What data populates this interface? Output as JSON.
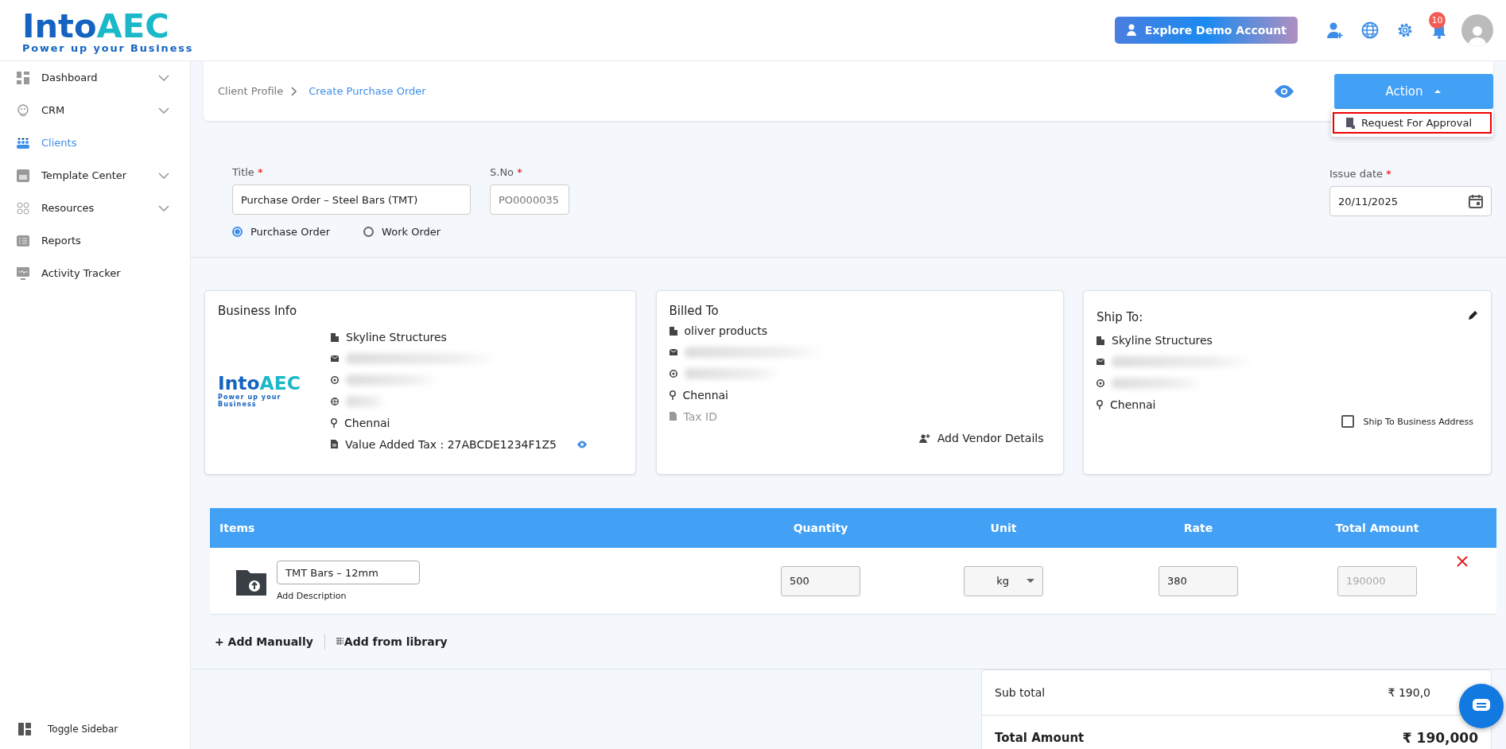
{
  "logo": {
    "word_1": "Into",
    "word_2": "AEC",
    "tagline": "Power up your Business"
  },
  "card_logo": {
    "word_1": "Into",
    "word_2": "AEC",
    "tagline": "Power up your Business"
  },
  "header": {
    "demo_button": "Explore Demo Account",
    "notification_count": "10"
  },
  "sidebar": {
    "items": [
      {
        "label": "Dashboard",
        "expandable": true,
        "selected": false
      },
      {
        "label": "CRM",
        "expandable": true,
        "selected": false
      },
      {
        "label": "Clients",
        "expandable": false,
        "selected": true
      },
      {
        "label": "Template Center",
        "expandable": true,
        "selected": false
      },
      {
        "label": "Resources",
        "expandable": true,
        "selected": false
      },
      {
        "label": "Reports",
        "expandable": false,
        "selected": false
      },
      {
        "label": "Activity Tracker",
        "expandable": false,
        "selected": false
      }
    ],
    "toggle": "Toggle Sidebar"
  },
  "breadcrumb": [
    "Client Profile",
    "Create Purchase Order"
  ],
  "action": {
    "label": "Action",
    "expanded": true,
    "menu": [
      {
        "label": "Request For Approval",
        "highlighted": true
      }
    ]
  },
  "form": {
    "title": {
      "label": "Title",
      "required_mark": "*",
      "value": "Purchase Order – Steel Bars (TMT)"
    },
    "serial": {
      "label": "S.No",
      "required_mark": "*",
      "placeholder": "PO0000035"
    },
    "issue_date": {
      "label": "Issue date",
      "required_mark": "*",
      "value": "20/11/2025"
    },
    "order_types": [
      {
        "label": "Purchase Order",
        "selected": true
      },
      {
        "label": "Work Order",
        "selected": false
      }
    ]
  },
  "business_info": {
    "title": "Business Info",
    "company": "Skyline Structures",
    "city": "Chennai",
    "tax": "Value Added Tax : 27ABCDE1234F1Z5"
  },
  "billed_to": {
    "title": "Billed To",
    "company": "oliver products",
    "city": "Chennai",
    "tax_placeholder": "Tax ID",
    "add_vendor": "Add Vendor Details"
  },
  "ship_to": {
    "title": "Ship To:",
    "company": "Skyline Structures",
    "city": "Chennai",
    "same_as_business": {
      "label": "Ship To Business Address",
      "checked": false
    }
  },
  "items": {
    "columns": [
      "Items",
      "Quantity",
      "Unit",
      "Rate",
      "Total Amount"
    ],
    "rows": [
      {
        "name": "TMT Bars – 12mm",
        "description_link": "Add Description",
        "quantity": "500",
        "unit": "kg",
        "rate": "380",
        "total": "190000"
      }
    ],
    "add_manually": "+ Add Manually",
    "add_library": "Add from library"
  },
  "totals": {
    "subtotal_label": "Sub total",
    "subtotal_value": "₹ 190,0",
    "total_label": "Total Amount",
    "total_value": "₹ 190,000"
  }
}
